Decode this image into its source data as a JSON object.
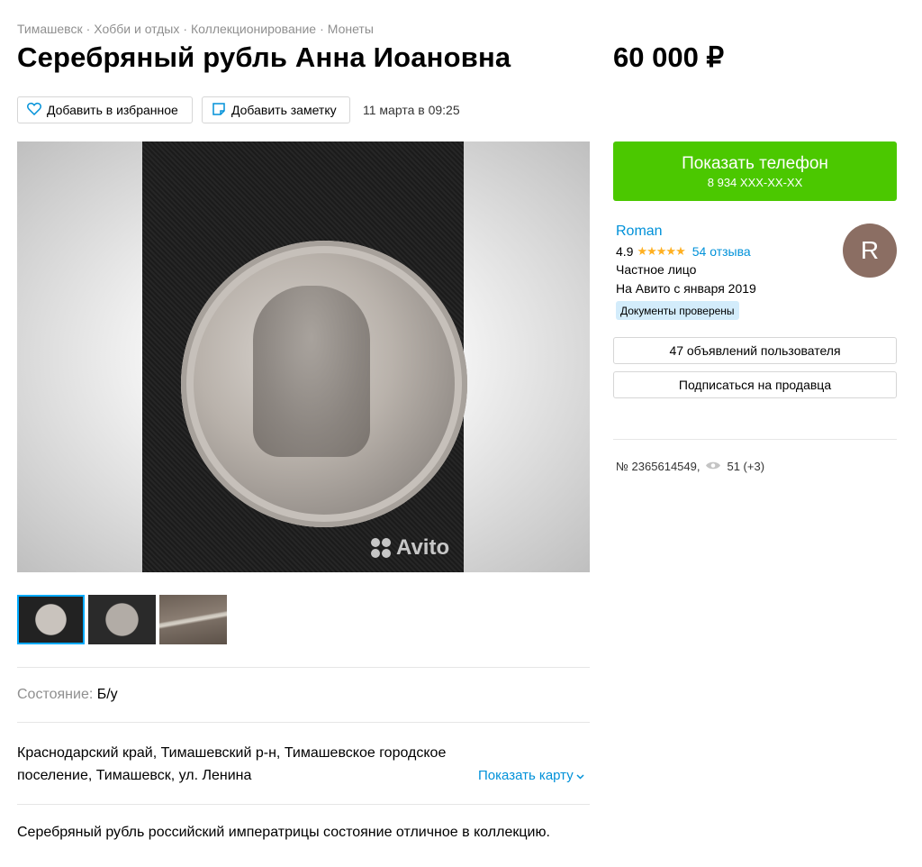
{
  "breadcrumb": [
    "Тимашевск",
    "Хобби и отдых",
    "Коллекционирование",
    "Монеты"
  ],
  "breadcrumb_sep": "·",
  "listing": {
    "title": "Серебряный рубль Анна Иоановна",
    "price": "60 000 ₽",
    "date": "11 марта в 09:25",
    "condition_label": "Состояние:",
    "condition_value": "Б/у",
    "address": "Краснодарский край, Тимашевский р-н, Тимашевское городское поселение, Тимашевск, ул. Ленина",
    "show_map": "Показать карту",
    "description": "Серебряный рубль российский императрицы состояние отличное в коллекцию.",
    "watermark": "Avito",
    "thumbnails": 3,
    "active_thumbnail": 1
  },
  "actions": {
    "favorite": "Добавить в избранное",
    "note": "Добавить заметку"
  },
  "contact": {
    "show_phone": "Показать телефон",
    "phone_masked": "8 934 XXX-XX-XX"
  },
  "seller": {
    "name": "Roman",
    "rating": "4.9",
    "stars": "★★★★★",
    "reviews": "54 отзыва",
    "type": "Частное лицо",
    "since": "На Авито с января 2019",
    "verified": "Документы проверены",
    "avatar_letter": "R",
    "avatar_color": "#8b6e63",
    "ads_button": "47 объявлений пользователя",
    "subscribe_button": "Подписаться на продавца"
  },
  "meta": {
    "item_number": "№ 2365614549,",
    "views": "51 (+3)"
  },
  "colors": {
    "accent_green": "#4bc800",
    "link_blue": "#0091d9",
    "star_orange": "#ffb021"
  }
}
